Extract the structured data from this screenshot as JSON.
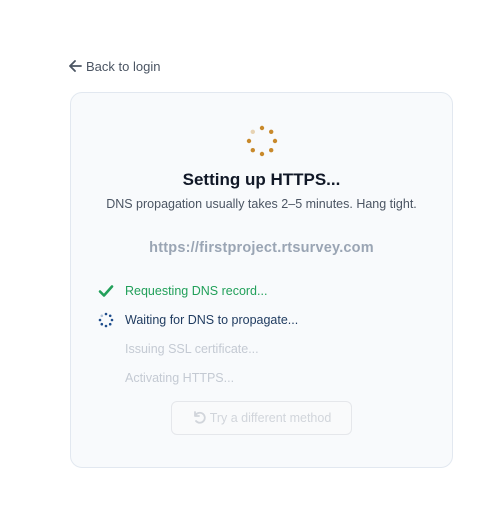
{
  "nav": {
    "back_label": "Back to login",
    "back_icon": "arrow-left-icon"
  },
  "card": {
    "title": "Setting up HTTPS...",
    "subtitle": "DNS propagation usually takes 2–5 minutes. Hang tight.",
    "domain": "https://firstproject.rtsurvey.com",
    "steps": [
      {
        "label": "Requesting DNS record...",
        "status": "done"
      },
      {
        "label": "Waiting for DNS to propagate...",
        "status": "active"
      },
      {
        "label": "Issuing SSL certificate...",
        "status": "pending"
      },
      {
        "label": "Activating HTTPS...",
        "status": "pending"
      }
    ],
    "retry_button": {
      "label": "Try a different method",
      "icon": "undo-icon",
      "disabled": true
    }
  },
  "colors": {
    "spinner": "#c8892b",
    "done": "#22a05a",
    "active": "#1e3a5f",
    "pending": "#c4cad3"
  }
}
